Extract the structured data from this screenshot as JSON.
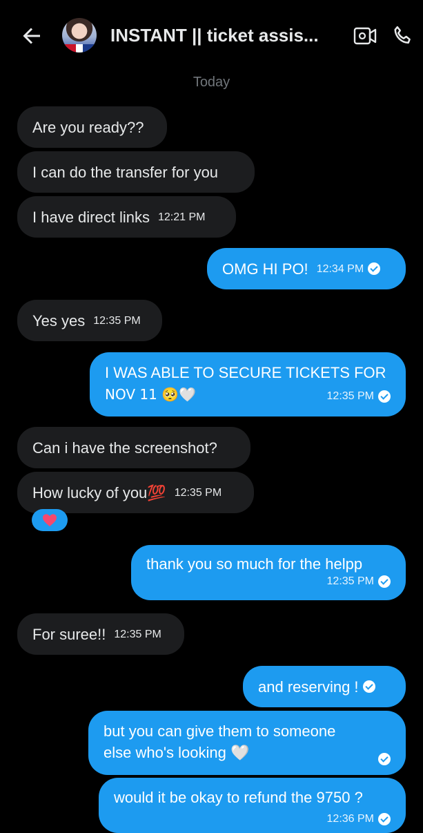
{
  "header": {
    "title": "INSTANT || ticket assis...",
    "back_icon": "arrow-left-icon",
    "video_icon": "video-call-icon",
    "phone_icon": "phone-call-icon"
  },
  "day_separator": "Today",
  "colors": {
    "background": "#000000",
    "incoming_bubble": "#1c1d1f",
    "outgoing_bubble": "#1d9bf0",
    "muted_text": "#71767b"
  },
  "messages": [
    {
      "direction": "in",
      "text": "Are you ready??",
      "time": ""
    },
    {
      "direction": "in",
      "text": "I can do the transfer for you",
      "time": ""
    },
    {
      "direction": "in",
      "text": "I have direct links",
      "time": "12:21 PM"
    },
    {
      "direction": "out",
      "text": "OMG HI PO!",
      "time": "12:34 PM"
    },
    {
      "direction": "in",
      "text": "Yes yes",
      "time": "12:35 PM"
    },
    {
      "direction": "out",
      "text": "I WAS ABLE TO SECURE TICKETS FOR",
      "text_line2": "NOV 11 🥺🤍",
      "time": "12:35 PM"
    },
    {
      "direction": "in",
      "text": "Can i have the screenshot?",
      "time": ""
    },
    {
      "direction": "in",
      "text": "How lucky of you💯",
      "time": "12:35 PM",
      "reaction": "❤️"
    },
    {
      "direction": "out",
      "text": "thank you so much for the helpp",
      "time": "12:35 PM"
    },
    {
      "direction": "in",
      "text": "For suree!!",
      "time": "12:35 PM"
    },
    {
      "direction": "out",
      "text": "and reserving !",
      "time": ""
    },
    {
      "direction": "out",
      "text": "but you can give them to someone",
      "text_line2": "else who's looking 🤍",
      "time": ""
    },
    {
      "direction": "out",
      "text": "would it be okay to refund the 9750 ?",
      "time": "12:36 PM"
    }
  ]
}
